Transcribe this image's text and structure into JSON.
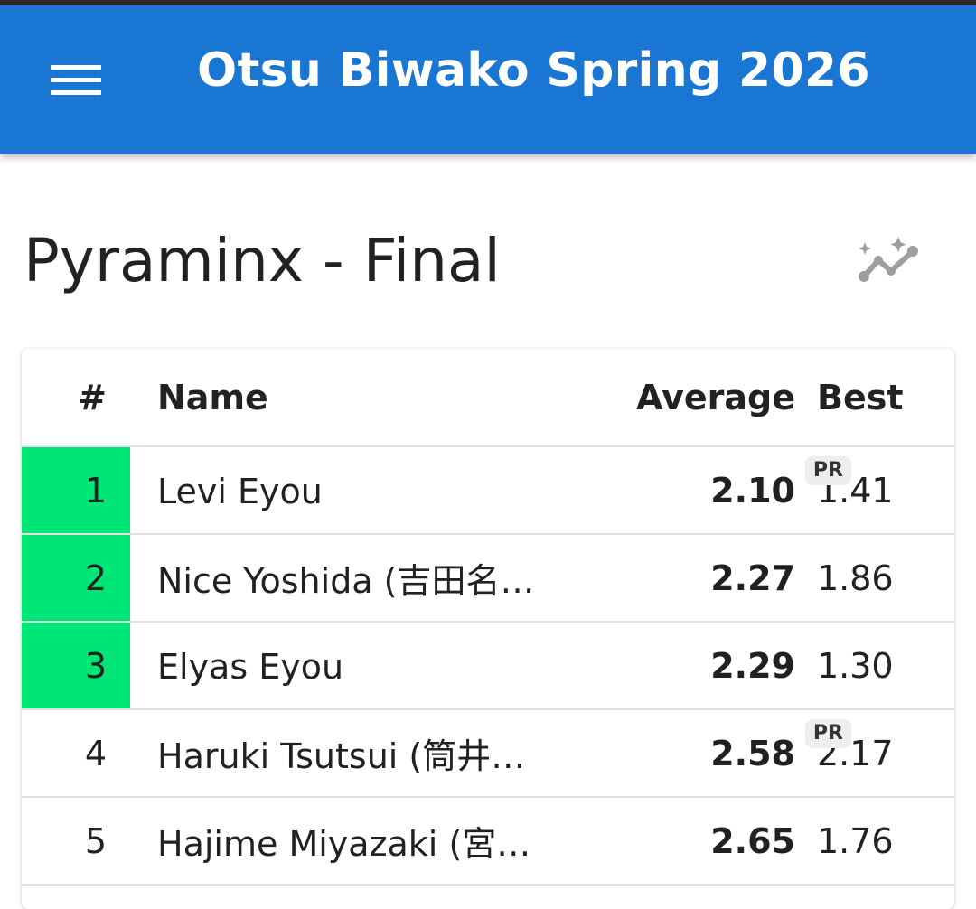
{
  "app": {
    "title": "Otsu Biwako Spring 2026"
  },
  "page": {
    "title": "Pyraminx - Final"
  },
  "icons": {
    "menu": "menu-icon",
    "chart": "auto-graph-icon"
  },
  "colors": {
    "appbar": "#1976d2",
    "advancing": "#00e676"
  },
  "table": {
    "headers": {
      "rank": "#",
      "name": "Name",
      "average": "Average",
      "best": "Best"
    },
    "rows": [
      {
        "rank": "1",
        "name": "Levi Eyou",
        "average": "2.10",
        "average_tag": "PR",
        "best": "1.41",
        "best_tag": "",
        "advancing": true
      },
      {
        "rank": "2",
        "name": "Nice Yoshida (吉田名…",
        "average": "2.27",
        "average_tag": "",
        "best": "1.86",
        "best_tag": "",
        "advancing": true
      },
      {
        "rank": "3",
        "name": "Elyas Eyou",
        "average": "2.29",
        "average_tag": "",
        "best": "1.30",
        "best_tag": "",
        "advancing": true
      },
      {
        "rank": "4",
        "name": "Haruki Tsutsui (筒井遥…",
        "average": "2.58",
        "average_tag": "PR",
        "best": "2.17",
        "best_tag": "",
        "advancing": false
      },
      {
        "rank": "5",
        "name": "Hajime Miyazaki (宮崎…",
        "average": "2.65",
        "average_tag": "",
        "best": "1.76",
        "best_tag": "",
        "advancing": false
      }
    ]
  }
}
